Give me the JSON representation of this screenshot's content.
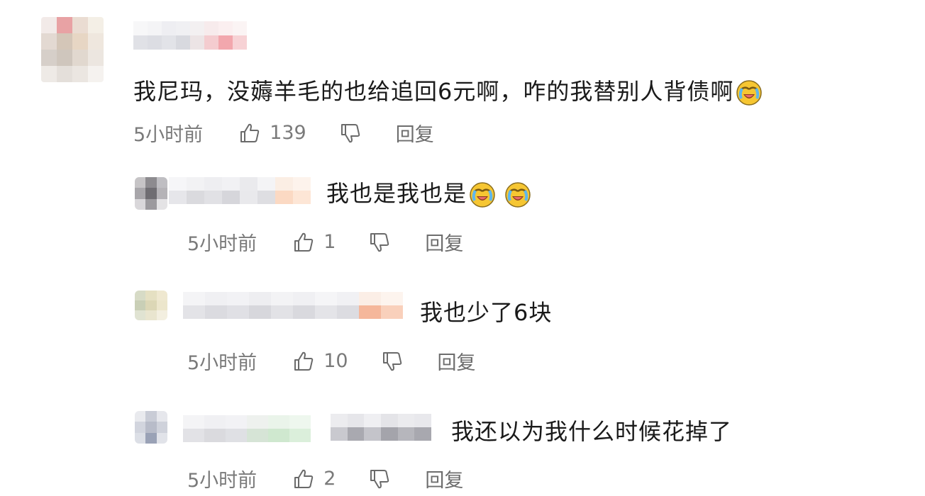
{
  "comments": [
    {
      "text": "我尼玛，没薅羊毛的也给追回6元啊，咋的我替别人背债啊",
      "emoji": "crying-laughing-emoji",
      "time": "5小时前",
      "likes": "139",
      "reply_label": "回复"
    }
  ],
  "replies": [
    {
      "text": "我也是我也是",
      "emoji_count": 2,
      "emoji": "crying-laughing-emoji",
      "time": "5小时前",
      "likes": "1",
      "reply_label": "回复"
    },
    {
      "text": "我也少了6块",
      "time": "5小时前",
      "likes": "10",
      "reply_label": "回复"
    },
    {
      "text": "我还以为我什么时候花掉了",
      "time": "5小时前",
      "likes": "2",
      "reply_label": "回复"
    }
  ],
  "icons": {
    "like": "thumbs-up-icon",
    "dislike": "thumbs-down-icon"
  },
  "colors": {
    "text": "#1a1a1a",
    "meta": "#7a7a7a",
    "emoji_face": "#f6c632"
  }
}
